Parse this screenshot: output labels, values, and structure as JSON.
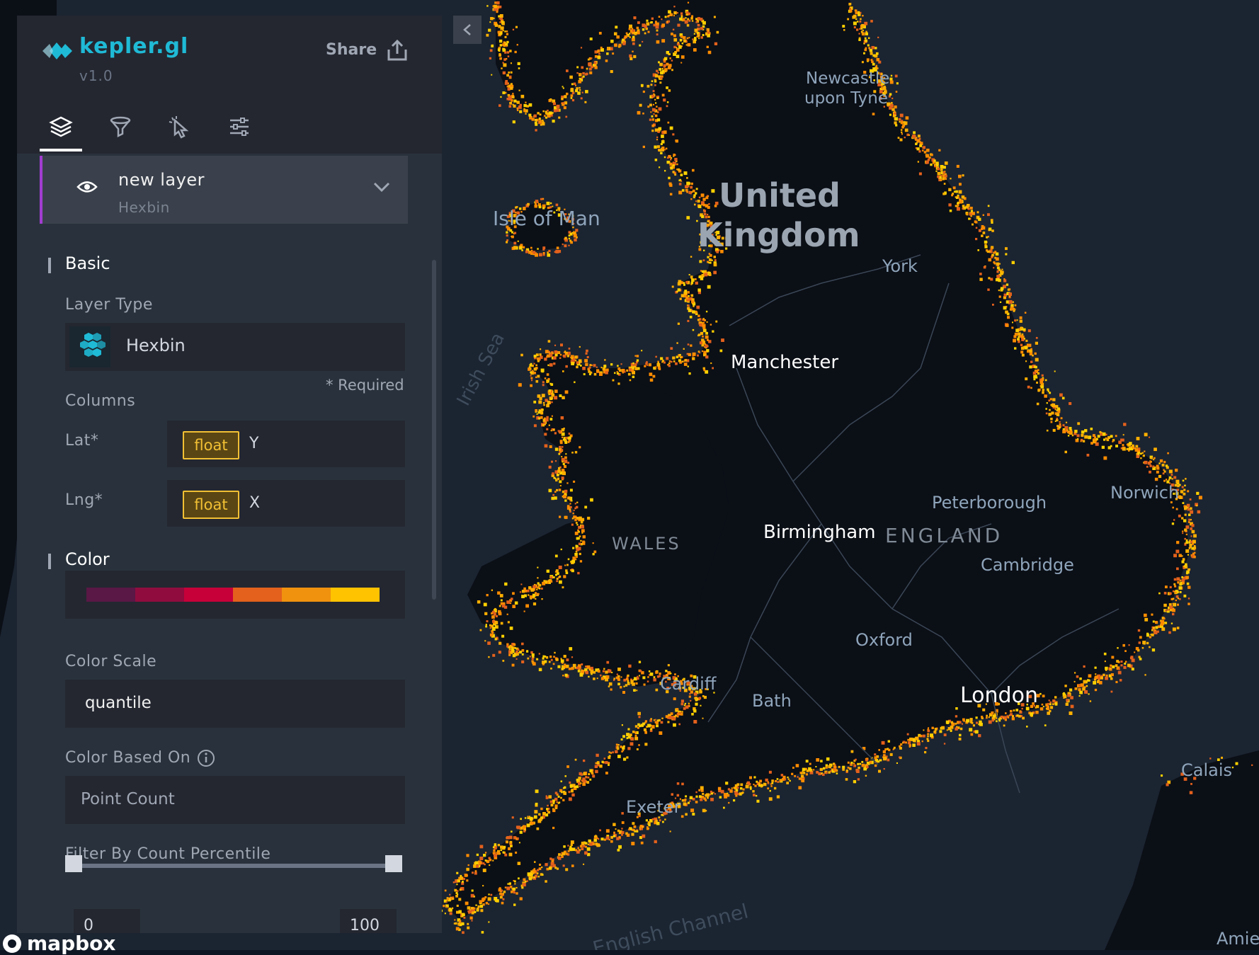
{
  "app": {
    "title": "kepler.gl",
    "version": "v1.0",
    "share_label": "Share"
  },
  "tabs": [
    {
      "name": "layers",
      "icon": "layers-icon",
      "active": true
    },
    {
      "name": "filters",
      "icon": "filter-icon",
      "active": false
    },
    {
      "name": "interactions",
      "icon": "cursor-click-icon",
      "active": false
    },
    {
      "name": "map-settings",
      "icon": "sliders-icon",
      "active": false
    }
  ],
  "layer": {
    "name": "new layer",
    "type": "Hexbin",
    "visible": true,
    "accent": "#a23dd0"
  },
  "basic": {
    "section": "Basic",
    "layer_type_label": "Layer Type",
    "layer_type_value": "Hexbin",
    "columns_label": "Columns",
    "required_label": "* Required",
    "lat_label": "Lat*",
    "lat_type": "float",
    "lat_column": "Y",
    "lng_label": "Lng*",
    "lng_type": "float",
    "lng_column": "X"
  },
  "color": {
    "section": "Color",
    "palette": [
      "#5a1846",
      "#900c3f",
      "#c70039",
      "#e3611c",
      "#f1920e",
      "#ffc300"
    ],
    "scale_label": "Color Scale",
    "scale_value": "quantile",
    "based_on_label": "Color Based On",
    "based_on_value": "Point Count",
    "filter_label": "Filter By Count Percentile",
    "range_min": "0",
    "range_max": "100",
    "range_fraction": [
      0,
      1
    ]
  },
  "map": {
    "labels": {
      "newcastle_1": "Newcastle",
      "newcastle_2": "upon Tyne",
      "country_1": "United",
      "country_2": "Kingdom",
      "isle_of_man": "Isle of Man",
      "york": "York",
      "irish_sea": "Irish Sea",
      "manchester": "Manchester",
      "peterborough": "Peterborough",
      "norwich": "Norwich",
      "wales": "WALES",
      "birmingham": "Birmingham",
      "england": "ENGLAND",
      "cambridge": "Cambridge",
      "oxford": "Oxford",
      "cardiff": "Cardiff",
      "bath": "Bath",
      "london": "London",
      "calais": "Calais",
      "exeter": "Exeter",
      "english_channel": "English Channel",
      "amiens": "Amiens"
    },
    "attribution": "mapbox",
    "land_color": "#0b0f16",
    "sea_color": "#1b2431",
    "hex_colors": [
      "#ff8c00",
      "#ffb000",
      "#ffd000",
      "#e3611c"
    ]
  }
}
